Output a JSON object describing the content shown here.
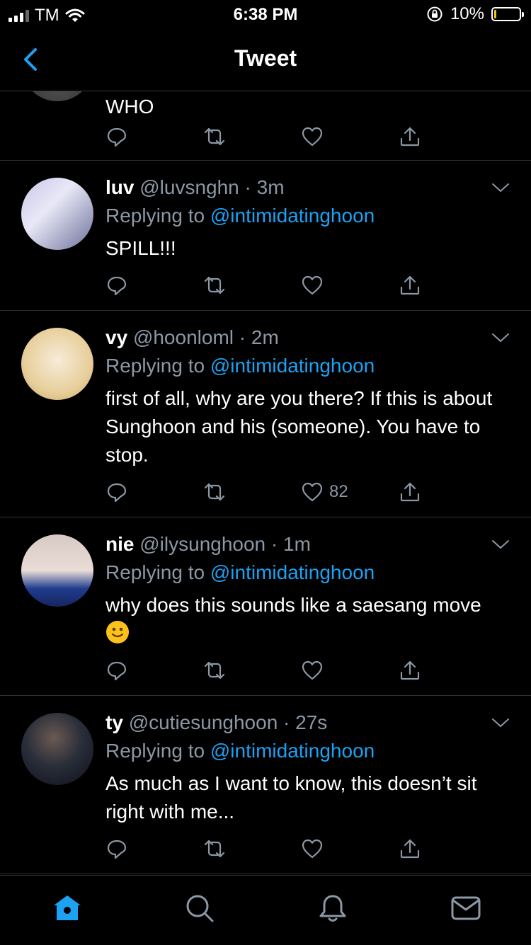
{
  "status": {
    "carrier": "TM",
    "time": "6:38 PM",
    "battery": "10%",
    "battery_level": 0.1
  },
  "nav": {
    "title": "Tweet"
  },
  "partial_tweet": {
    "text": "WHO"
  },
  "tweets": [
    {
      "name": "luv",
      "handle": "@luvsnghn",
      "time": "3m",
      "replying_prefix": "Replying to ",
      "replying_to": "@intimidatinghoon",
      "text": "SPILL!!!",
      "likes": ""
    },
    {
      "name": "vy",
      "handle": "@hoonloml",
      "time": "2m",
      "replying_prefix": "Replying to ",
      "replying_to": "@intimidatinghoon",
      "text": "first of all, why are you there? If this is about Sunghoon and his (someone). You have to stop.",
      "likes": "82"
    },
    {
      "name": "nie",
      "handle": "@ilysunghoon",
      "time": "1m",
      "replying_prefix": "Replying to ",
      "replying_to": "@intimidatinghoon",
      "text": "why does this sounds like a saesang move",
      "emoji": "slightly-smiling-face",
      "likes": ""
    },
    {
      "name": "ty",
      "handle": "@cutiesunghoon",
      "time": "27s",
      "replying_prefix": "Replying to ",
      "replying_to": "@intimidatinghoon",
      "text": "As much as I want to know, this doesn’t sit right with me...",
      "likes": ""
    }
  ],
  "separator": " · ",
  "colors": {
    "accent": "#1da1f2",
    "muted": "#8b98a5",
    "divider": "#2f3336",
    "background": "#000000"
  },
  "tabbar": {
    "items": [
      "home-icon",
      "search-icon",
      "notifications-icon",
      "messages-icon"
    ],
    "active": "home-icon"
  }
}
